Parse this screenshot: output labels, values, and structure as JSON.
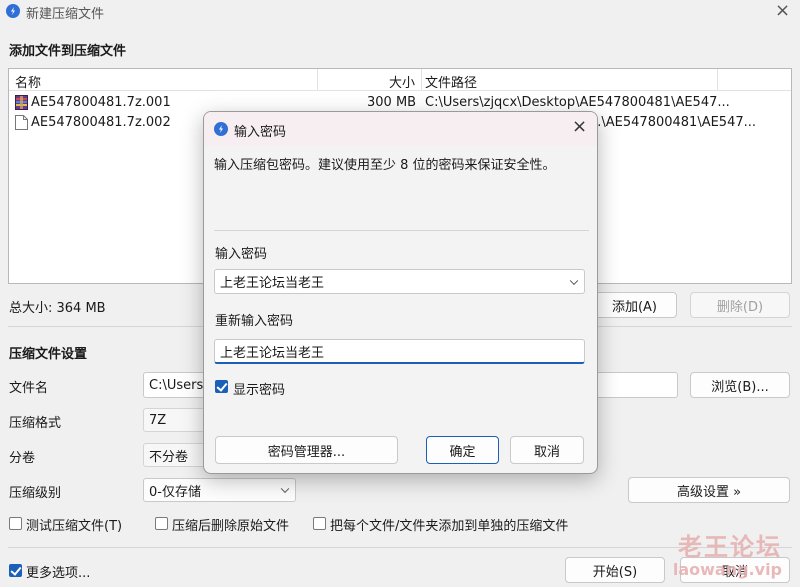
{
  "window": {
    "title": "新建压缩文件",
    "close_label": "×"
  },
  "files_section": {
    "title": "添加文件到压缩文件",
    "columns": [
      "名称",
      "大小",
      "文件路径"
    ],
    "rows": [
      {
        "name": "AE547800481.7z.001",
        "size": "300 MB",
        "path": "C:\\Users\\zjqcx\\Desktop\\AE547800481\\AE547...",
        "icon": "archive-file-icon"
      },
      {
        "name": "AE547800481.7z.002",
        "size": "",
        "path": "...\\AE547800481\\AE547...",
        "icon": "blank-file-icon"
      }
    ],
    "total_size": "总大小: 364 MB",
    "add_button": "添加(A)",
    "delete_button": "删除(D)"
  },
  "settings": {
    "title": "压缩文件设置",
    "filename_label": "文件名",
    "filename_value": "C:\\Users\\",
    "browse_button": "浏览(B)...",
    "format_label": "压缩格式",
    "format_value": "7Z",
    "split_label": "分卷",
    "split_value": "不分卷",
    "level_label": "压缩级别",
    "level_value": "0-仅存储",
    "advanced_button": "高级设置 »",
    "test_checkbox": "测试压缩文件(T)",
    "delete_after_checkbox": "压缩后删除原始文件",
    "separate_checkbox": "把每个文件/文件夹添加到单独的压缩文件"
  },
  "footer": {
    "more_options": "更多选项...",
    "start_button": "开始(S)",
    "cancel_button": "取消"
  },
  "dialog": {
    "title": "输入密码",
    "close_label": "×",
    "description": "输入压缩包密码。建议使用至少 8 位的密码来保证安全性。",
    "password_label": "输入密码",
    "password_value": "上老王论坛当老王",
    "confirm_label": "重新输入密码",
    "confirm_value": "上老王论坛当老王",
    "show_password": "显示密码",
    "manager_button": "密码管理器...",
    "ok_button": "确定",
    "cancel_button": "取消"
  },
  "watermark": {
    "line1": "老王论坛",
    "line2": "laowang.vip"
  },
  "colors": {
    "accent": "#1c5fb8",
    "app_icon": "#2f6fd6",
    "watermark": "#e7b2b2"
  }
}
